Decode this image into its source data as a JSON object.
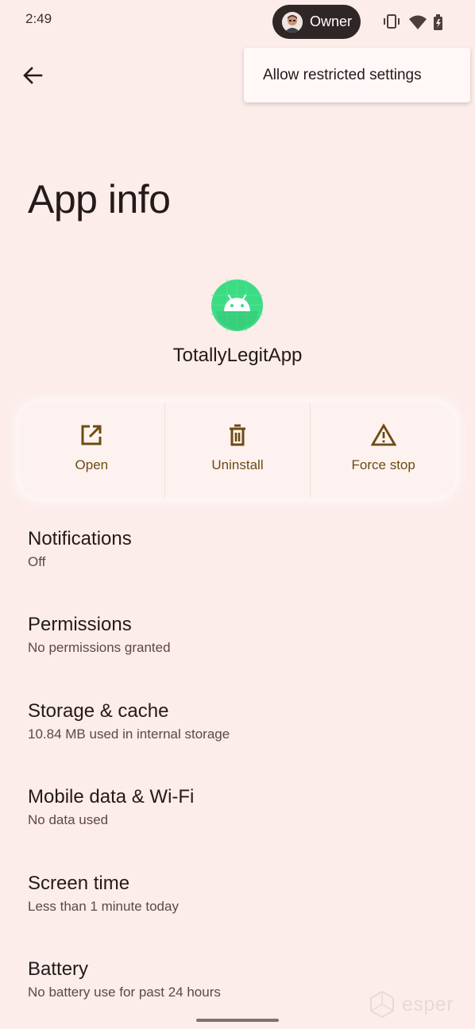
{
  "status_bar": {
    "time": "2:49",
    "user_chip": "Owner",
    "icons": [
      "vibrate-icon",
      "wifi-icon",
      "battery-charging-icon"
    ]
  },
  "menu": {
    "items": [
      "Allow restricted settings"
    ]
  },
  "header": {
    "back_icon": "arrow-back-icon",
    "title": "App info"
  },
  "app": {
    "icon": "android-icon",
    "name": "TotallyLegitApp"
  },
  "actions": [
    {
      "label": "Open",
      "icon": "open-external-icon"
    },
    {
      "label": "Uninstall",
      "icon": "trash-icon"
    },
    {
      "label": "Force stop",
      "icon": "warning-icon"
    }
  ],
  "settings": [
    {
      "title": "Notifications",
      "summary": "Off"
    },
    {
      "title": "Permissions",
      "summary": "No permissions granted"
    },
    {
      "title": "Storage & cache",
      "summary": "10.84 MB used in internal storage"
    },
    {
      "title": "Mobile data & Wi-Fi",
      "summary": "No data used"
    },
    {
      "title": "Screen time",
      "summary": "Less than 1 minute today"
    },
    {
      "title": "Battery",
      "summary": "No battery use for past 24 hours"
    }
  ],
  "watermark": "esper",
  "colors": {
    "background": "#fcecea",
    "accent": "#6e4a12",
    "app_icon_green": "#3ddc84"
  }
}
